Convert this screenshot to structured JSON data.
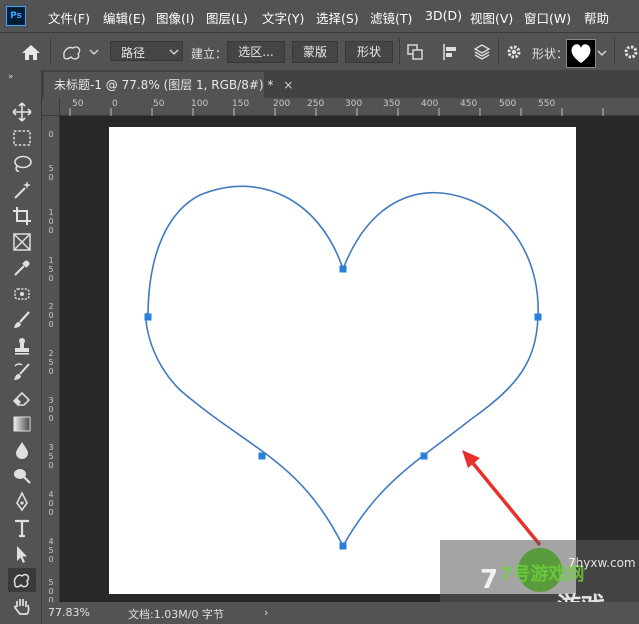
{
  "app": {
    "logo_text": "Ps"
  },
  "menu": [
    {
      "label": "文件(F)"
    },
    {
      "label": "编辑(E)"
    },
    {
      "label": "图像(I)"
    },
    {
      "label": "图层(L)"
    },
    {
      "label": "文字(Y)"
    },
    {
      "label": "选择(S)"
    },
    {
      "label": "滤镜(T)"
    },
    {
      "label": "3D(D)"
    },
    {
      "label": "视图(V)"
    },
    {
      "label": "窗口(W)"
    },
    {
      "label": "帮助"
    }
  ],
  "options": {
    "mode_value": "路径",
    "build_label": "建立：",
    "selection_button": "选区...",
    "mask_button": "蒙版",
    "shape_button": "形状",
    "shape_label": "形状："
  },
  "document": {
    "tab_title": "未标题-1 @ 77.8% (图层 1, RGB/8#) *"
  },
  "ruler": {
    "h_ticks": [
      "50",
      "0",
      "50",
      "100",
      "150",
      "200",
      "250",
      "300",
      "350",
      "400",
      "450",
      "500",
      "550"
    ],
    "v_ticks": [
      "0",
      "5\n0",
      "1\n0\n0",
      "1\n5\n0",
      "2\n0\n0",
      "2\n5\n0",
      "3\n0\n0",
      "3\n5\n0",
      "4\n0\n0",
      "4\n5\n0",
      "5\n0\n0"
    ]
  },
  "status": {
    "zoom": "77.83%",
    "doc_info": "文档:1.03M/0 字节",
    "arrow": "›"
  },
  "watermark": {
    "text": "7号游戏网",
    "url": "7hyxw.com",
    "subtitle": "游戏"
  },
  "colors": {
    "path_stroke": "#3f7bbf",
    "anchor": "#2a7fd8",
    "arrow": "#e8302c",
    "ui_bg": "#535353",
    "canvas_bg": "#ffffff"
  },
  "tools": [
    "move-tool",
    "marquee-tool",
    "lasso-tool",
    "magic-wand-tool",
    "crop-tool",
    "frame-tool",
    "eyedropper-tool",
    "healing-tool",
    "brush-tool",
    "clone-stamp-tool",
    "history-brush-tool",
    "eraser-tool",
    "gradient-tool",
    "blur-tool",
    "dodge-tool",
    "pen-tool",
    "type-tool",
    "path-selection-tool",
    "custom-shape-tool",
    "hand-tool"
  ]
}
